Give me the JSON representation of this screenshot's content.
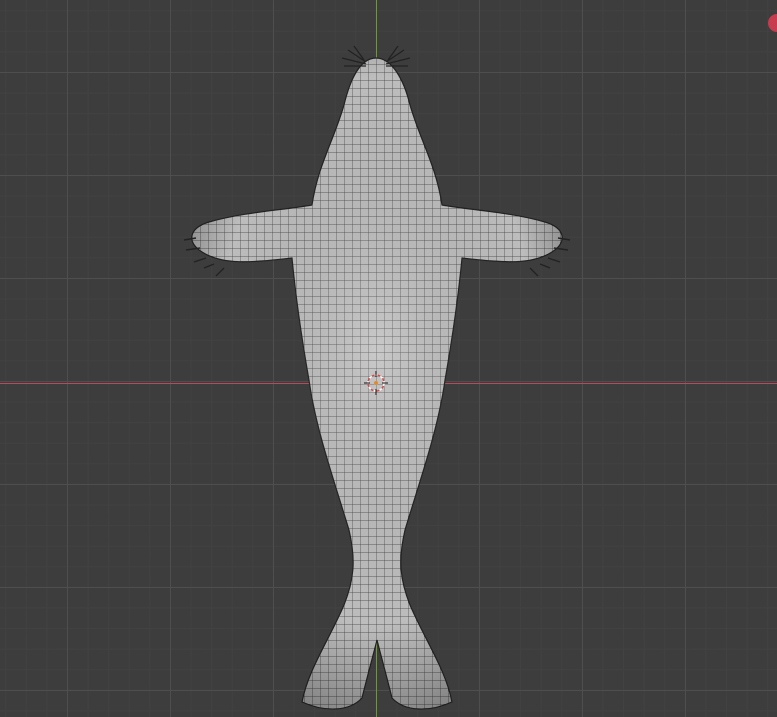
{
  "viewport": {
    "background_color": "#3d3d3d",
    "grid_color": "#505050",
    "x_axis_color": "#b94a58",
    "y_axis_color": "#6e9a2e",
    "mesh_color": "#b9b9b9",
    "wire_color": "#2a2a2a",
    "cursor_color": "#d24b4b"
  },
  "icons": {
    "cursor": "3d-cursor-icon",
    "gizmo": "navigation-gizmo-x-icon"
  }
}
